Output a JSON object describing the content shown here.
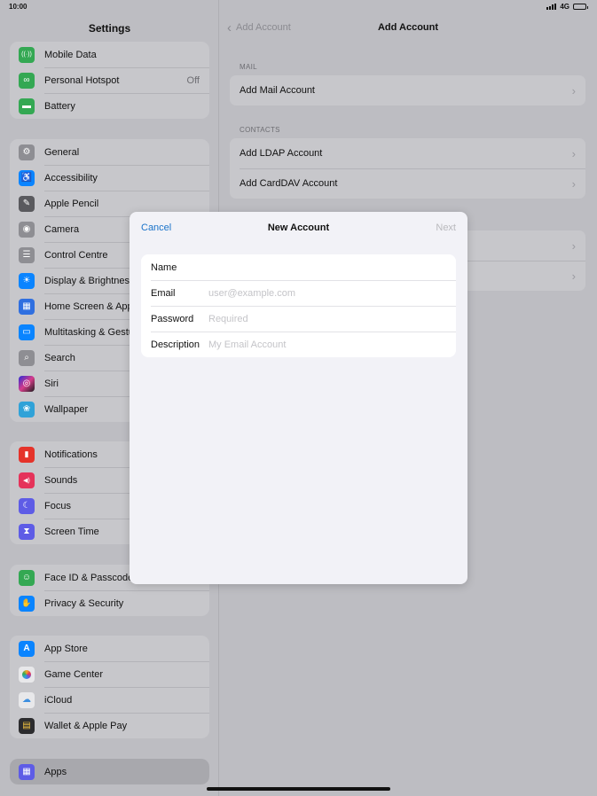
{
  "status_bar": {
    "time": "10:00",
    "network": "4G"
  },
  "sidebar": {
    "title": "Settings",
    "groups": [
      [
        {
          "label": "Mobile Data",
          "icon": "antenna-icon",
          "color": "#34a853",
          "glyph": "((·))"
        },
        {
          "label": "Personal Hotspot",
          "value": "Off",
          "icon": "link-icon",
          "color": "#34a853",
          "glyph": "∞"
        },
        {
          "label": "Battery",
          "icon": "battery-icon",
          "color": "#34a853",
          "glyph": "▬"
        }
      ],
      [
        {
          "label": "General",
          "icon": "gear-icon",
          "color": "#8e8e93",
          "glyph": "⚙"
        },
        {
          "label": "Accessibility",
          "icon": "accessibility-icon",
          "color": "#0a84ff",
          "glyph": "♿"
        },
        {
          "label": "Apple Pencil",
          "icon": "pencil-icon",
          "color": "#5a5a5e",
          "glyph": "✎"
        },
        {
          "label": "Camera",
          "icon": "camera-icon",
          "color": "#8e8e93",
          "glyph": "◉"
        },
        {
          "label": "Control Centre",
          "icon": "toggles-icon",
          "color": "#8e8e93",
          "glyph": "☰"
        },
        {
          "label": "Display & Brightness",
          "icon": "sun-icon",
          "color": "#0a84ff",
          "glyph": "☀"
        },
        {
          "label": "Home Screen & App Library",
          "icon": "home-screen-icon",
          "color": "#2f6fe0",
          "glyph": "▦"
        },
        {
          "label": "Multitasking & Gestures",
          "icon": "multitasking-icon",
          "color": "#0a84ff",
          "glyph": "▭"
        },
        {
          "label": "Search",
          "icon": "search-icon",
          "color": "#8e8e93",
          "glyph": "⌕"
        },
        {
          "label": "Siri",
          "icon": "siri-icon",
          "color": "#1c1c1e",
          "glyph": "◎"
        },
        {
          "label": "Wallpaper",
          "icon": "flower-icon",
          "color": "#30a2d8",
          "glyph": "❀"
        }
      ],
      [
        {
          "label": "Notifications",
          "icon": "bell-icon",
          "color": "#e5332a",
          "glyph": "🔔"
        },
        {
          "label": "Sounds",
          "icon": "speaker-icon",
          "color": "#e5335a",
          "glyph": "◀)"
        },
        {
          "label": "Focus",
          "icon": "moon-icon",
          "color": "#5e5ce6",
          "glyph": "☾"
        },
        {
          "label": "Screen Time",
          "icon": "hourglass-icon",
          "color": "#5e5ce6",
          "glyph": "⧗"
        }
      ],
      [
        {
          "label": "Face ID & Passcode",
          "icon": "face-id-icon",
          "color": "#34a853",
          "glyph": "☺"
        },
        {
          "label": "Privacy & Security",
          "icon": "hand-icon",
          "color": "#0a84ff",
          "glyph": "✋"
        }
      ],
      [
        {
          "label": "App Store",
          "icon": "app-store-icon",
          "color": "#0a84ff",
          "glyph": "A"
        },
        {
          "label": "Game Center",
          "icon": "game-center-icon",
          "color": "#e8e8ea",
          "glyph": "●"
        },
        {
          "label": "iCloud",
          "icon": "cloud-icon",
          "color": "#e8e8ea",
          "glyph": "☁"
        },
        {
          "label": "Wallet & Apple Pay",
          "icon": "wallet-icon",
          "color": "#2c2c2e",
          "glyph": "▤"
        }
      ],
      [
        {
          "label": "Apps",
          "icon": "apps-grid-icon",
          "color": "#5e5ce6",
          "glyph": "▦",
          "selected": true
        }
      ]
    ]
  },
  "detail": {
    "back_label": "Add Account",
    "title": "Add Account",
    "sections": [
      {
        "header": "MAIL",
        "items": [
          "Add Mail Account"
        ]
      },
      {
        "header": "CONTACTS",
        "items": [
          "Add LDAP Account",
          "Add CardDAV Account"
        ]
      }
    ]
  },
  "modal": {
    "cancel_label": "Cancel",
    "title": "New Account",
    "next_label": "Next",
    "fields": [
      {
        "label": "Name",
        "placeholder": "",
        "value": ""
      },
      {
        "label": "Email",
        "placeholder": "user@example.com",
        "value": ""
      },
      {
        "label": "Password",
        "placeholder": "Required",
        "value": ""
      },
      {
        "label": "Description",
        "placeholder": "My Email Account",
        "value": ""
      }
    ]
  }
}
